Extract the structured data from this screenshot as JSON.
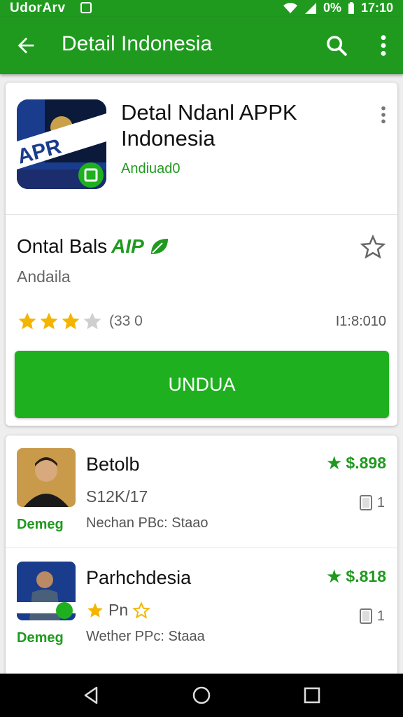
{
  "status": {
    "carrier": "UdorArv",
    "battery": "0%",
    "time": "17:10"
  },
  "appbar": {
    "title": "Detail Indonesia"
  },
  "app": {
    "name": "Detal Ndanl APPK Indonesia",
    "sub": "Andiuad0",
    "icon_text": "APR",
    "title2": "Ontal Bals",
    "title2_accent": "AIP",
    "developer": "Andaila",
    "rating_count": "(33 0",
    "size": "I1:8:010",
    "rating": 3.5,
    "install_label": "UNDUA"
  },
  "list": [
    {
      "name": "Betolb",
      "line2": "S12K/17",
      "badge": "Demeg",
      "line3": "Nechan PBc: Staao",
      "price": "★ $.898",
      "copies": "1"
    },
    {
      "name": "Parhchdesia",
      "line2": "Pn",
      "badge": "Demeg",
      "line3": "Wether PPc: Staaa",
      "price": "★ $.818",
      "copies": "1"
    }
  ],
  "colors": {
    "brand_green": "#1f9a1f",
    "button_green": "#1fb01f",
    "star": "#f4b400"
  },
  "icons": [
    "back-arrow-icon",
    "search-icon",
    "more-vert-icon",
    "star-outline-icon",
    "star-icon",
    "copy-icon",
    "nav-back-icon",
    "nav-home-icon",
    "nav-recents-icon",
    "leaf-icon"
  ]
}
